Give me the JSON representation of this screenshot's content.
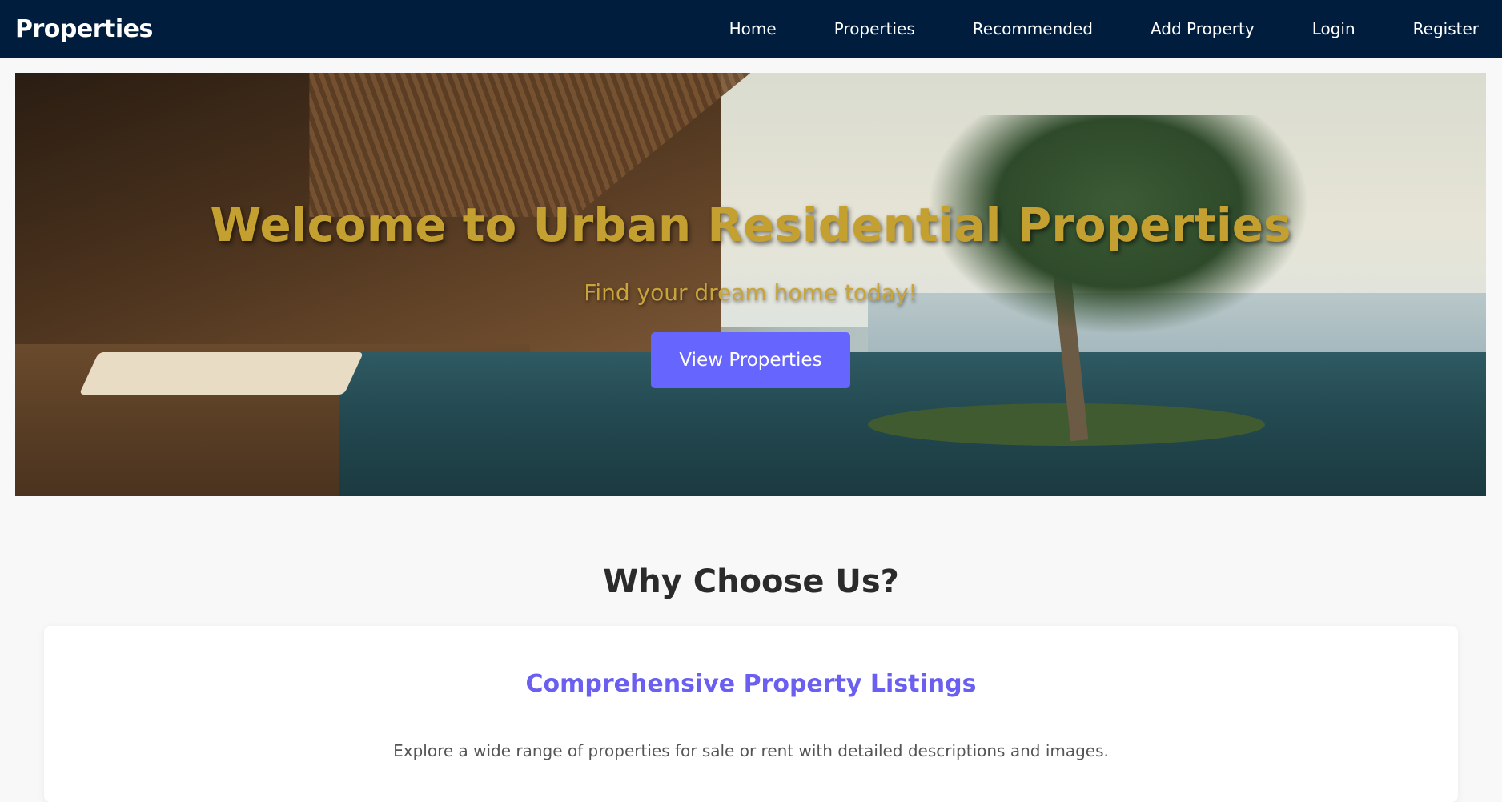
{
  "navbar": {
    "brand": "Properties",
    "links": [
      {
        "label": "Home"
      },
      {
        "label": "Properties"
      },
      {
        "label": "Recommended"
      },
      {
        "label": "Add Property"
      },
      {
        "label": "Login"
      },
      {
        "label": "Register"
      }
    ]
  },
  "hero": {
    "title": "Welcome to Urban Residential Properties",
    "subtitle": "Find your dream home today!",
    "cta_label": "View Properties"
  },
  "why_choose_us": {
    "title": "Why Choose Us?",
    "features": [
      {
        "title": "Comprehensive Property Listings",
        "text": "Explore a wide range of properties for sale or rent with detailed descriptions and images."
      }
    ]
  },
  "colors": {
    "navbar_bg": "#001d3d",
    "accent": "#6666ff",
    "hero_title": "#c4a030",
    "feature_title": "#6a5ff0"
  }
}
